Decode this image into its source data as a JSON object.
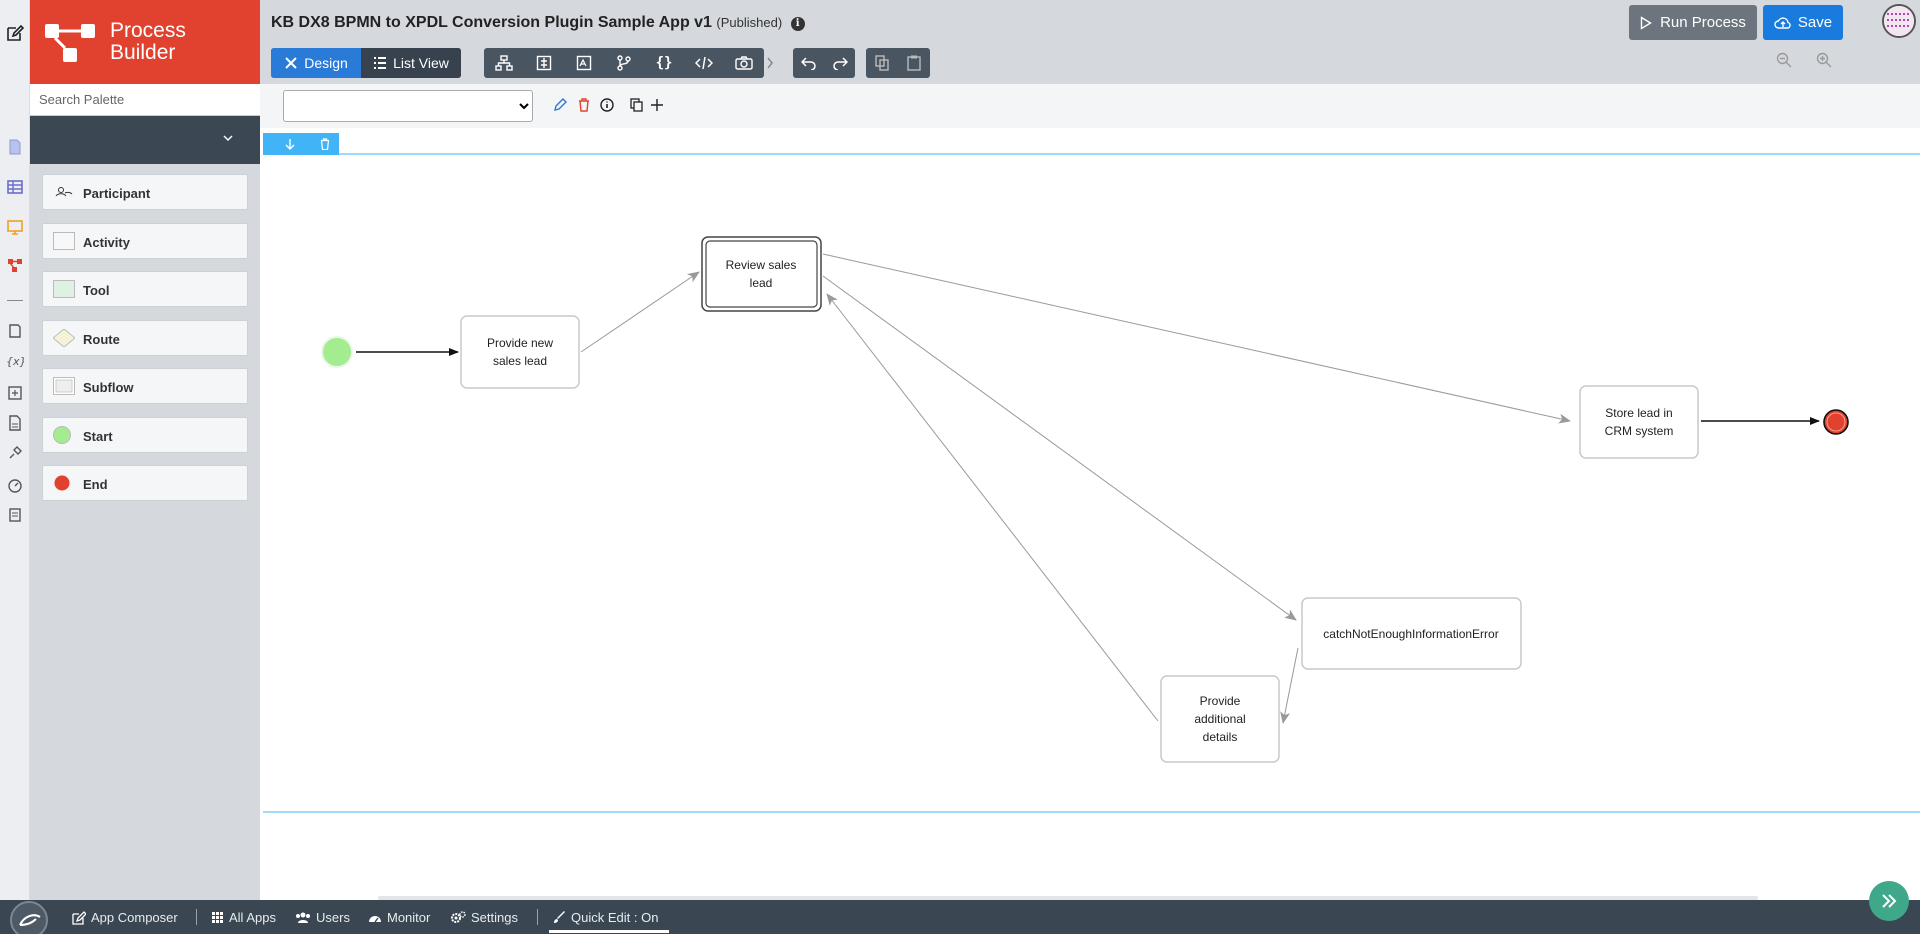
{
  "app": {
    "name": "Process Builder",
    "name_line1": "Process",
    "name_line2": "Builder",
    "title": "KB DX8 BPMN to XPDL Conversion Plugin Sample App v1",
    "status": "(Published)"
  },
  "palette": {
    "search_placeholder": "Search Palette",
    "items": [
      {
        "label": "Participant",
        "icon": "participant-icon"
      },
      {
        "label": "Activity",
        "icon": "activity-icon"
      },
      {
        "label": "Tool",
        "icon": "tool-icon"
      },
      {
        "label": "Route",
        "icon": "route-icon"
      },
      {
        "label": "Subflow",
        "icon": "subflow-icon"
      },
      {
        "label": "Start",
        "icon": "start-icon"
      },
      {
        "label": "End",
        "icon": "end-icon"
      }
    ]
  },
  "toolbar": {
    "design_label": "Design",
    "listview_label": "List View",
    "run_label": "Run Process",
    "save_label": "Save"
  },
  "diagram": {
    "nodes": {
      "provide_new_line1": "Provide new",
      "provide_new_line2": "sales lead",
      "review_line1": "Review sales",
      "review_line2": "lead",
      "store_line1": "Store lead in",
      "store_line2": "CRM system",
      "catch_error": "catchNotEnoughInformationError",
      "additional_line1": "Provide",
      "additional_line2": "additional",
      "additional_line3": "details"
    }
  },
  "bottombar": {
    "app_composer": "App Composer",
    "all_apps": "All Apps",
    "users": "Users",
    "monitor": "Monitor",
    "settings": "Settings",
    "quick_edit": "Quick Edit : On"
  },
  "colors": {
    "brand": "#e0422f",
    "accent": "#2a7ad8",
    "pool_border": "#40b4f7",
    "start": "#a3ec90",
    "end": "#e0422f"
  }
}
